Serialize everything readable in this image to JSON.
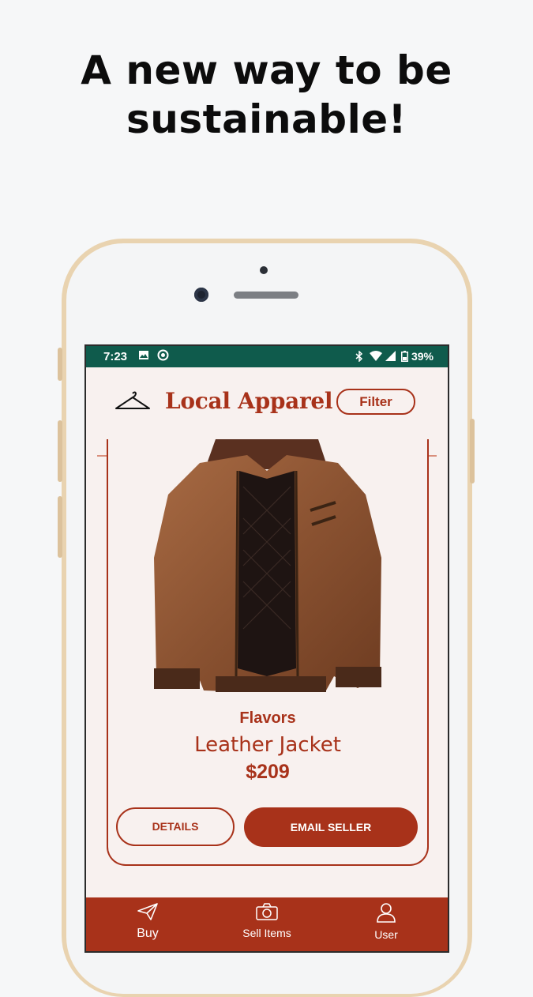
{
  "headline": {
    "line1": "A new way to be",
    "line2": "sustainable!"
  },
  "status_bar": {
    "time": "7:23",
    "battery": "39%"
  },
  "app_bar": {
    "title": "Local Apparel",
    "filter_label": "Filter",
    "logo_icon": "hanger-icon"
  },
  "product": {
    "seller": "Flavors",
    "name": "Leather Jacket",
    "price": "$209",
    "details_label": "DETAILS",
    "email_label": "EMAIL SELLER"
  },
  "bottom_nav": {
    "items": [
      {
        "label": "Buy",
        "icon": "send-icon"
      },
      {
        "label": "Sell Items",
        "icon": "camera-icon"
      },
      {
        "label": "User",
        "icon": "user-icon"
      }
    ]
  },
  "colors": {
    "accent": "#a8321a",
    "status_bar": "#0f5b4c",
    "background": "#f8f1ef"
  }
}
